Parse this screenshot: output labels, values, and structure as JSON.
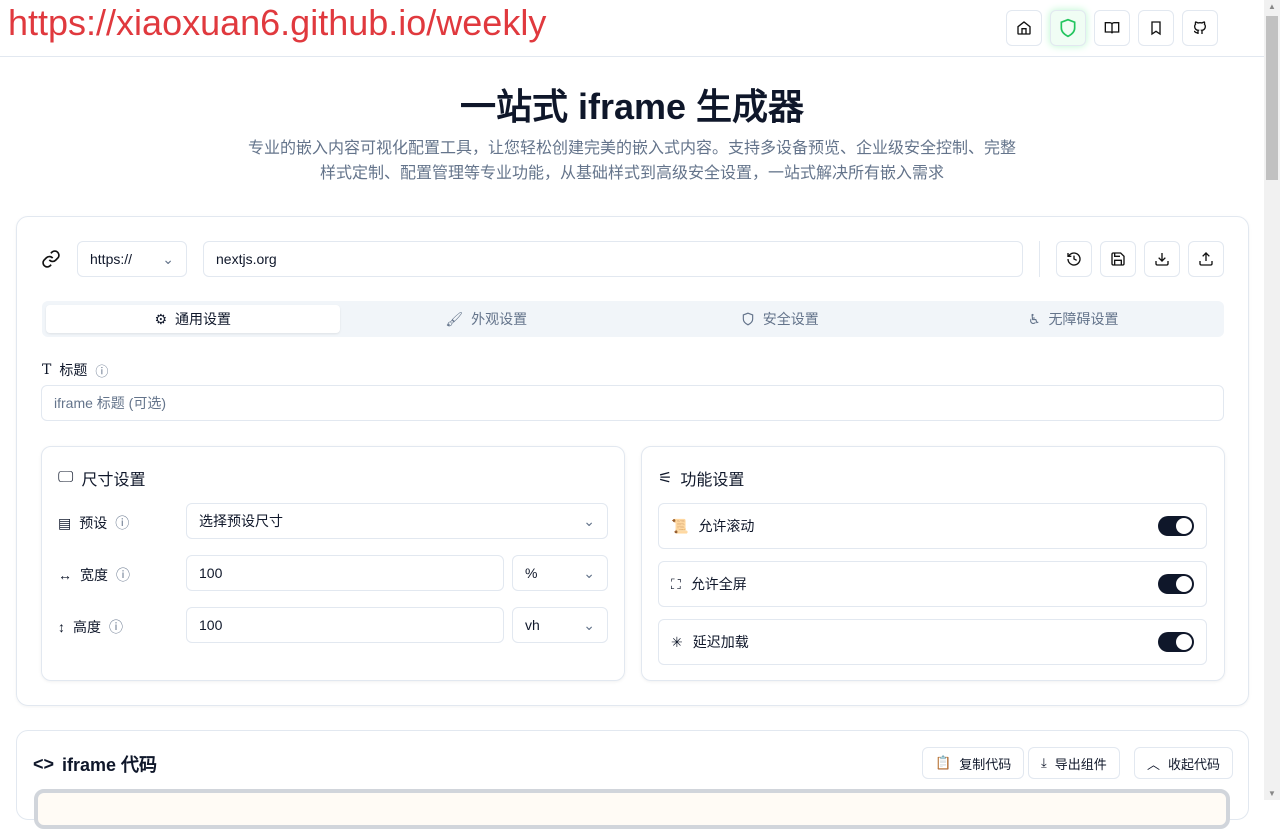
{
  "watermark": "https://xiaoxuan6.github.io/weekly",
  "header": {
    "icons": [
      "home-icon",
      "shield-icon",
      "book-icon",
      "bookmark-icon",
      "github-icon"
    ]
  },
  "hero": {
    "title": "一站式 iframe 生成器",
    "subtitle_line1": "专业的嵌入内容可视化配置工具，让您轻松创建完美的嵌入式内容。支持多设备预览、企业级安全控制、完整",
    "subtitle_line2": "样式定制、配置管理等专业功能，从基础样式到高级安全设置，一站式解决所有嵌入需求"
  },
  "url": {
    "protocol": "https://",
    "value": "nextjs.org"
  },
  "tabs": [
    "通用设置",
    "外观设置",
    "安全设置",
    "无障碍设置"
  ],
  "title_field": {
    "label": "标题",
    "placeholder": "iframe 标题 (可选)"
  },
  "size": {
    "heading": "尺寸设置",
    "preset_label": "预设",
    "preset_value": "选择预设尺寸",
    "width_label": "宽度",
    "width_value": "100",
    "width_unit": "%",
    "height_label": "高度",
    "height_value": "100",
    "height_unit": "vh"
  },
  "features": {
    "heading": "功能设置",
    "items": [
      {
        "label": "允许滚动",
        "on": true
      },
      {
        "label": "允许全屏",
        "on": true
      },
      {
        "label": "延迟加载",
        "on": true
      }
    ]
  },
  "code": {
    "heading": "iframe 代码",
    "copy": "复制代码",
    "export": "导出组件",
    "collapse": "收起代码"
  }
}
